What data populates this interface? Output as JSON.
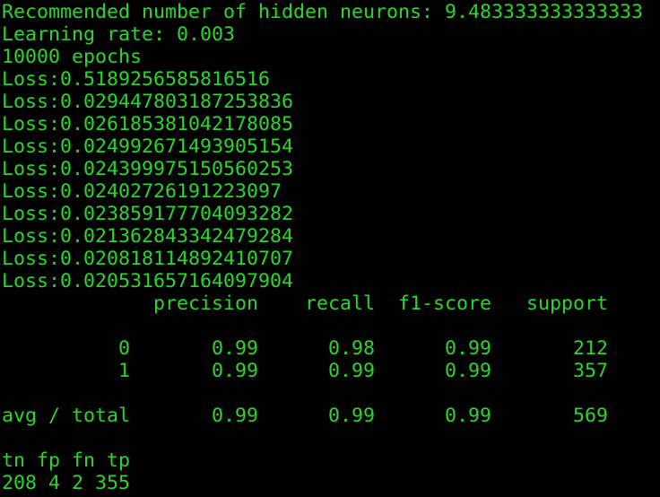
{
  "terminal": {
    "text_color": "#2bd62b",
    "background_color": "#000000",
    "lines": [
      "Recommended number of hidden neurons: 9.483333333333333",
      "Learning rate: 0.003",
      "10000 epochs",
      "Loss:0.5189256585816516",
      "Loss:0.029447803187253836",
      "Loss:0.026185381042178085",
      "Loss:0.024992671493905154",
      "Loss:0.024399975150560253",
      "Loss:0.02402726191223097",
      "Loss:0.023859177704093282",
      "Loss:0.021362843342479284",
      "Loss:0.020818114892410707",
      "Loss:0.020531657164097904",
      "             precision    recall  f1-score   support",
      "",
      "          0       0.99      0.98      0.99       212",
      "          1       0.99      0.99      0.99       357",
      "",
      "avg / total       0.99      0.99      0.99       569",
      "",
      "tn fp fn tp",
      "208 4 2 355"
    ]
  }
}
